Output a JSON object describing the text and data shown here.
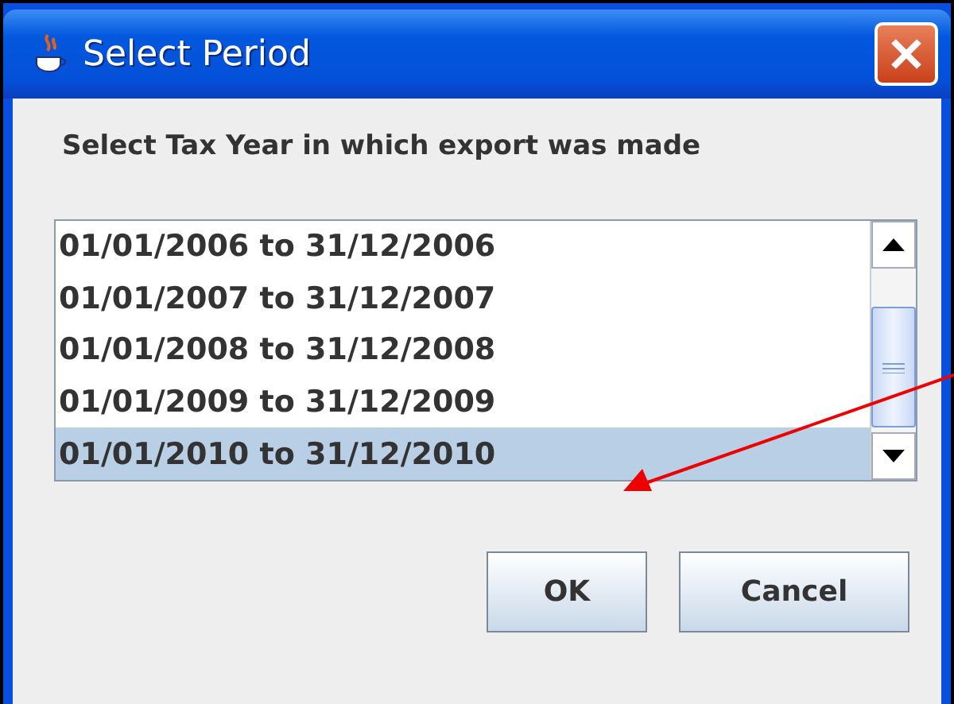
{
  "window": {
    "title": "Select Period"
  },
  "prompt": "Select Tax Year in which export was made",
  "periods": [
    {
      "label": "01/01/2006 to 31/12/2006",
      "selected": false
    },
    {
      "label": "01/01/2007 to 31/12/2007",
      "selected": false
    },
    {
      "label": "01/01/2008 to 31/12/2008",
      "selected": false
    },
    {
      "label": "01/01/2009 to 31/12/2009",
      "selected": false
    },
    {
      "label": "01/01/2010 to 31/12/2010",
      "selected": true
    }
  ],
  "buttons": [
    "OK",
    "Cancel"
  ]
}
